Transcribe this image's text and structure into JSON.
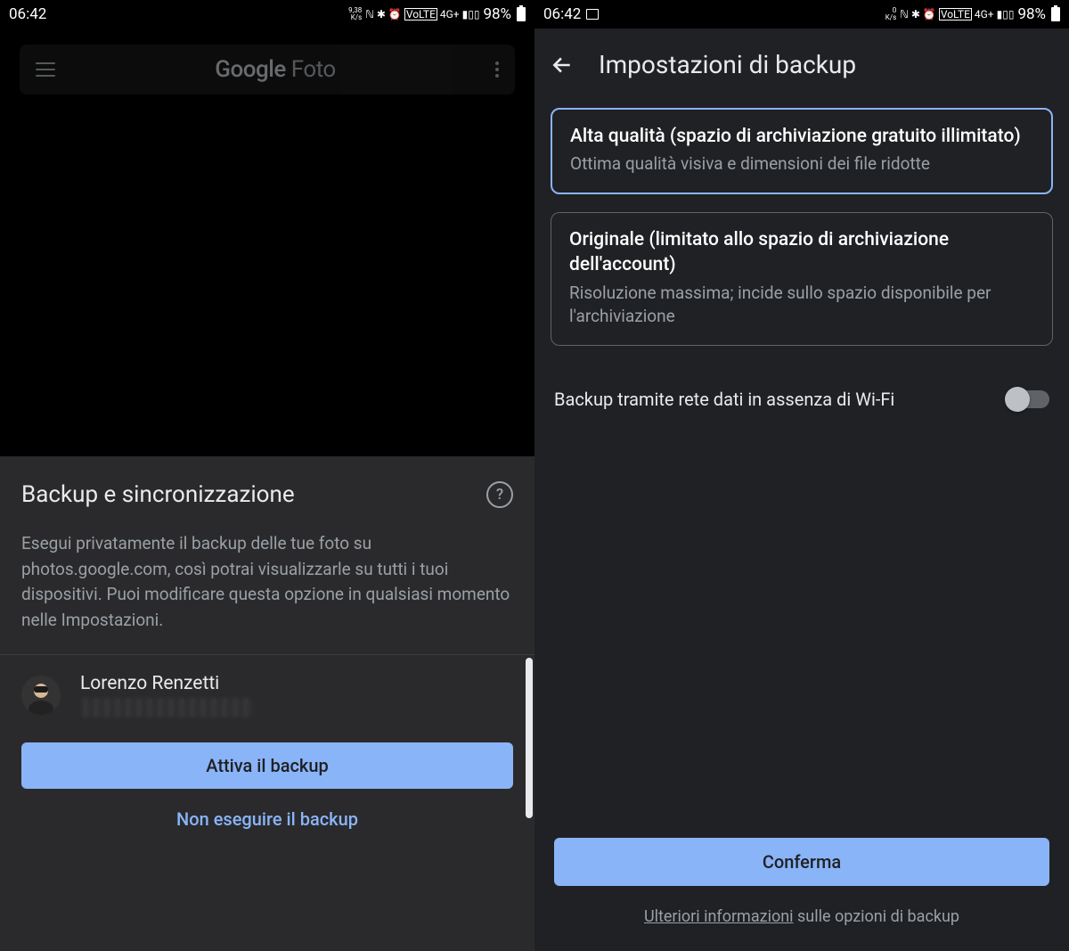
{
  "left": {
    "status": {
      "time": "06:42",
      "kps": "9,38\nK/s",
      "battery": "98%"
    },
    "app_title_bold": "Google",
    "app_title_light": " Foto",
    "sheet": {
      "title": "Backup e sincronizzazione",
      "desc": "Esegui privatamente il backup delle tue foto su photos.google.com, così potrai visualizzarle su tutti i tuoi dispositivi. Puoi modificare questa opzione in qualsiasi momento nelle Impostazioni.",
      "account_name": "Lorenzo Renzetti",
      "primary_btn": "Attiva il backup",
      "text_btn": "Non eseguire il backup"
    }
  },
  "right": {
    "status": {
      "time": "06:42",
      "kps": "0\nK/s",
      "battery": "98%"
    },
    "title": "Impostazioni di backup",
    "options": [
      {
        "title": "Alta qualità (spazio di archiviazione gratuito illimitato)",
        "sub": "Ottima qualità visiva e dimensioni dei file ridotte",
        "selected": true
      },
      {
        "title": "Originale (limitato allo spazio di archiviazione dell'account)",
        "sub": "Risoluzione massima; incide sullo spazio disponibile per l'archiviazione",
        "selected": false
      }
    ],
    "toggle_label": "Backup tramite rete dati in assenza di Wi-Fi",
    "confirm_btn": "Conferma",
    "footer_underline": "Ulteriori informazioni",
    "footer_rest": " sulle opzioni di backup"
  }
}
